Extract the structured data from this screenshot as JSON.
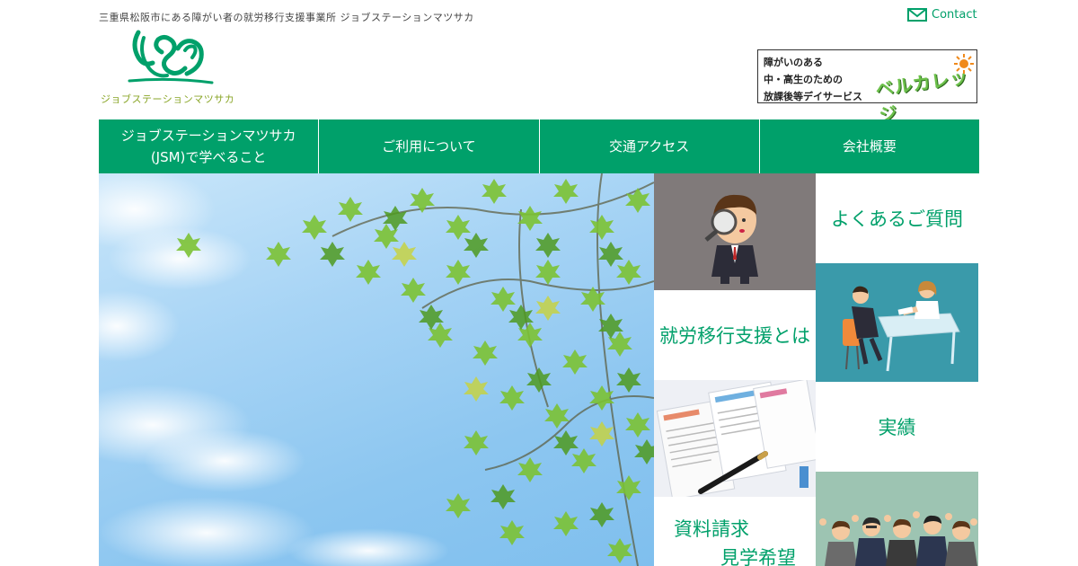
{
  "header": {
    "tagline": "三重県松阪市にある障がい者の就労移行支援事業所 ジョブステーションマツサカ",
    "logo_text": "ジョブステーションマツサカ",
    "contact_label": "Contact"
  },
  "banner": {
    "line1": "障がいのある",
    "line2": "中・高生のための",
    "line3": "放課後等デイサービス",
    "brand": "ベルカレッジ"
  },
  "nav": {
    "items": [
      {
        "line1": "ジョブステーションマツサカ",
        "line2": "(JSM)で学べること"
      },
      {
        "line1": "ご利用について"
      },
      {
        "line1": "交通アクセス"
      },
      {
        "line1": "会社概要"
      }
    ]
  },
  "tiles": {
    "faq": "よくあるご質問",
    "about": "就労移行支援とは",
    "results": "実績",
    "request_line1": "資料請求",
    "request_line2": "見学希望"
  },
  "colors": {
    "brand_green": "#00a06a",
    "tile_teal": "#3a9aaa",
    "tile_gray": "#807a7a",
    "tile_sage": "#9dc4b2"
  }
}
